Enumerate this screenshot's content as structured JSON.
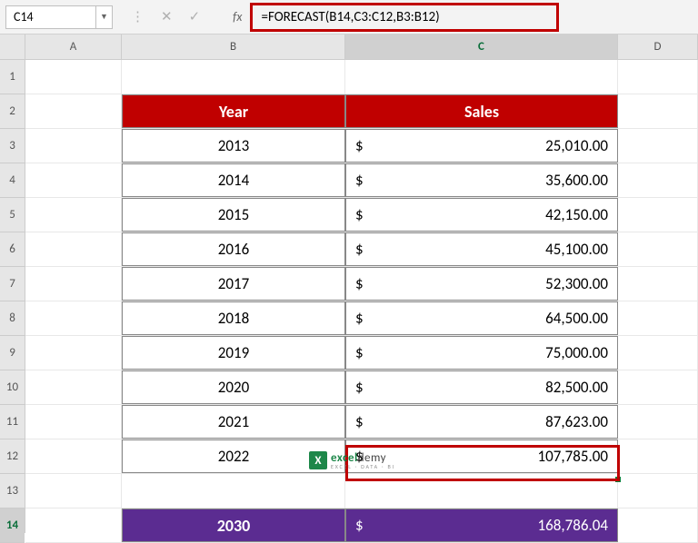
{
  "chart_data": {
    "type": "table",
    "columns": [
      "Year",
      "Sales"
    ],
    "rows": [
      [
        2013,
        25010.0
      ],
      [
        2014,
        35600.0
      ],
      [
        2015,
        42150.0
      ],
      [
        2016,
        45100.0
      ],
      [
        2017,
        52300.0
      ],
      [
        2018,
        64500.0
      ],
      [
        2019,
        75000.0
      ],
      [
        2020,
        82500.0
      ],
      [
        2021,
        87623.0
      ],
      [
        2022,
        107785.0
      ]
    ],
    "forecast": {
      "year": 2030,
      "value": 168786.04
    }
  },
  "name_box": "C14",
  "formula": "=FORECAST(B14,C3:C12,B3:B12)",
  "columns": {
    "a": "A",
    "b": "B",
    "c": "C",
    "d": "D"
  },
  "row_labels": [
    "1",
    "2",
    "3",
    "4",
    "5",
    "6",
    "7",
    "8",
    "9",
    "10",
    "11",
    "12",
    "13",
    "14"
  ],
  "header": {
    "year": "Year",
    "sales": "Sales"
  },
  "currency": "$",
  "data": [
    {
      "year": "2013",
      "sales": "25,010.00"
    },
    {
      "year": "2014",
      "sales": "35,600.00"
    },
    {
      "year": "2015",
      "sales": "42,150.00"
    },
    {
      "year": "2016",
      "sales": "45,100.00"
    },
    {
      "year": "2017",
      "sales": "52,300.00"
    },
    {
      "year": "2018",
      "sales": "64,500.00"
    },
    {
      "year": "2019",
      "sales": "75,000.00"
    },
    {
      "year": "2020",
      "sales": "82,500.00"
    },
    {
      "year": "2021",
      "sales": "87,623.00"
    },
    {
      "year": "2022",
      "sales": "107,785.00"
    }
  ],
  "forecast": {
    "year": "2030",
    "sales": "168,786.04"
  },
  "watermark": {
    "brand1": "excel",
    "brand2": "demy",
    "sub": "EXCEL · DATA · BI"
  }
}
